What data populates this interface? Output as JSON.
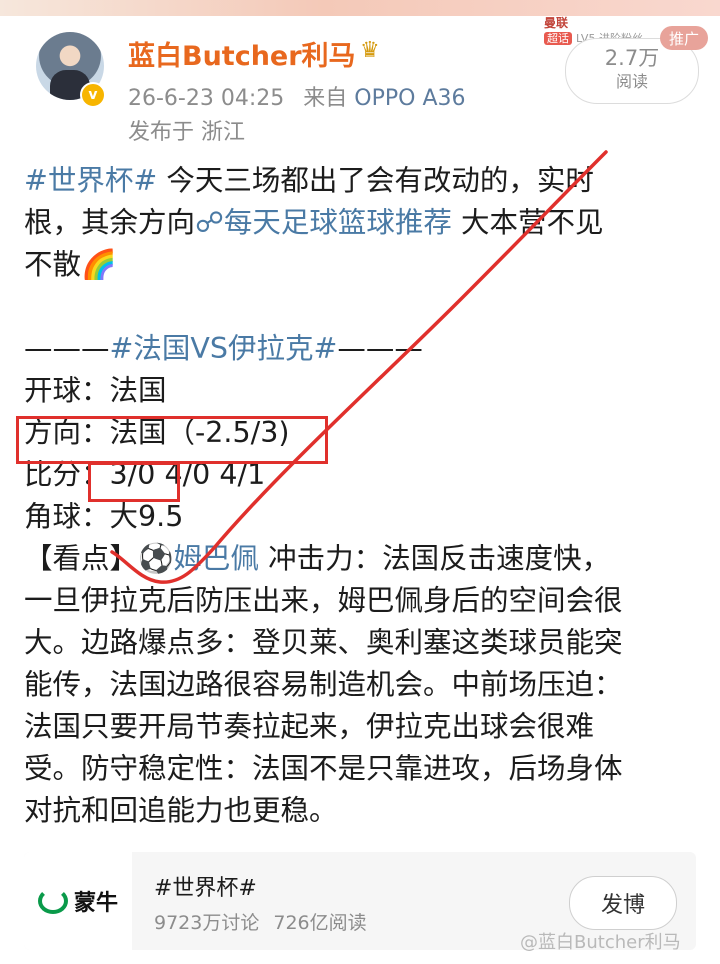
{
  "post": {
    "username": "蓝白Butcher利马",
    "timestamp": "26-6-23 04:25",
    "source_prefix": "来自",
    "device": "OPPO A36",
    "location": "发布于 浙江",
    "view_count": "2.7万",
    "view_label": "阅读",
    "promo_badge": "推广",
    "ad_brand": "曼联",
    "ad_chip": "超话",
    "ad_text": "LV5 进阶粉丝",
    "verified_symbol": "v",
    "crown_symbol": "♛"
  },
  "content": {
    "intro_tag": "#世界杯#",
    "intro_line1_rest": " 今天三场都出了会有改动的，实时",
    "intro_line2_pre": "根，其余方向",
    "link_icon": "☍",
    "link_text": "每天足球篮球推荐",
    "intro_line2_post": " 大本营不见",
    "intro_line3": "不散🌈",
    "match_prefix": "———",
    "match_tag": "#法国VS伊拉克#",
    "match_suffix": "———",
    "kickoff": "开球：法国",
    "direction": "方向：法国（-2.5/3)",
    "score_label": "比分：",
    "score_main": "3/0",
    "score_alt": " 4/0  4/1",
    "corners": "角球：大9.5",
    "highlight_label": "【看点】",
    "player_icon": "⚽",
    "player_tag": "姆巴佩",
    "highlight_line1_rest": " 冲击力：法国反击速度快，",
    "body_lines": [
      "一旦伊拉克后防压出来，姆巴佩身后的空间会很",
      "大。边路爆点多：登贝莱、奥利塞这类球员能突",
      "能传，法国边路很容易制造机会。中前场压迫：",
      "法国只要开局节奏拉起来，伊拉克出球会很难",
      "受。防守稳定性：法国不是只靠进攻，后场身体",
      "对抗和回追能力也更稳。"
    ]
  },
  "topic_card": {
    "logo_text": "蒙牛",
    "title": "#世界杯#",
    "discussions": "9723万讨论",
    "reads": "726亿阅读",
    "post_button": "发博"
  },
  "watermark": "@蓝白Butcher利马",
  "colors": {
    "username": "#e8681e",
    "hashtag": "#4a7aa5",
    "annotation_red": "#e0302c",
    "brand_green": "#0a9a4a"
  }
}
